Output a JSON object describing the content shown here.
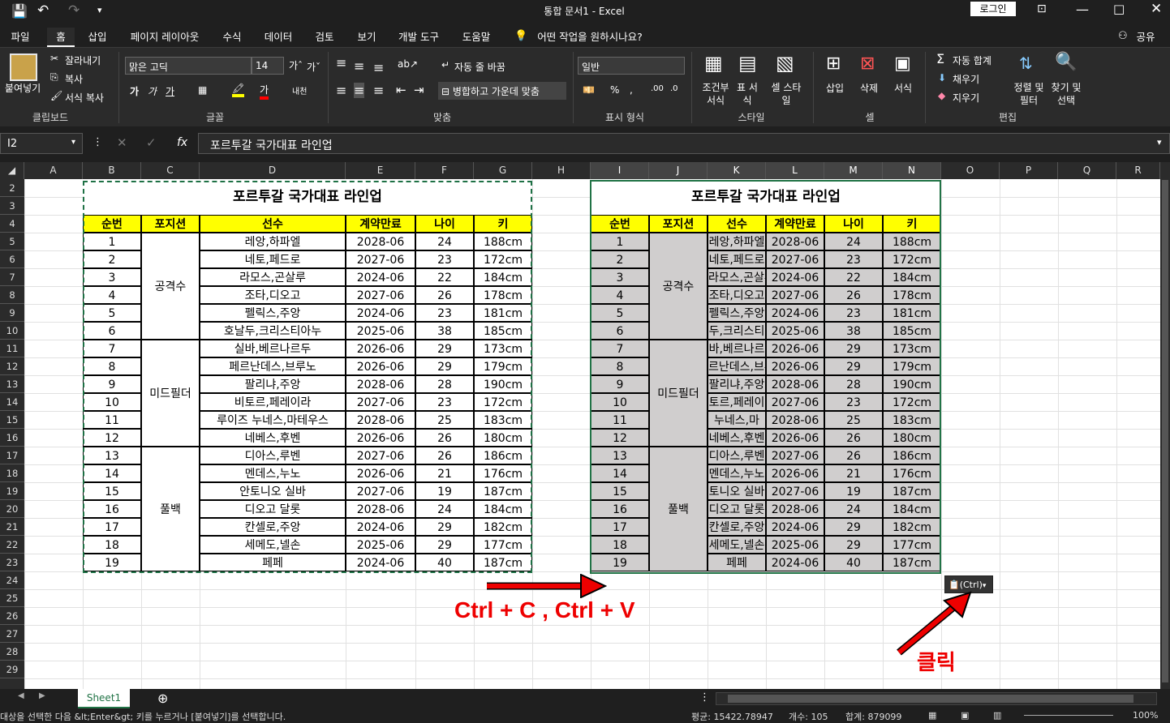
{
  "window": {
    "doc_title": "통합 문서1",
    "app": "Excel",
    "login": "로그인"
  },
  "tabs": [
    "파일",
    "홈",
    "삽입",
    "페이지 레이아웃",
    "수식",
    "데이터",
    "검토",
    "보기",
    "개발 도구",
    "도움말",
    "어떤 작업을 원하시나요?"
  ],
  "share": "공유",
  "ribbon": {
    "paste": "붙여넣기",
    "cut": "잘라내기",
    "copy": "복사",
    "format_painter": "서식 복사",
    "font_name": "맑은 고딕",
    "font_size": "14",
    "wrap": "자동 줄 바꿈",
    "merge": "병합하고 가운데 맞춤",
    "number_format": "일반",
    "cond_format": "조건부 서식",
    "table_format": "표 서식",
    "cell_style": "셀 스타일",
    "insert": "삽입",
    "delete": "삭제",
    "format": "서식",
    "autosum": "자동 합계",
    "fill": "채우기",
    "clear": "지우기",
    "sort": "정렬 및 필터",
    "find": "찾기 및 선택",
    "groups": [
      "클립보드",
      "글꼴",
      "맞춤",
      "표시 형식",
      "스타일",
      "셀",
      "편집"
    ]
  },
  "formula": {
    "name_box": "I2",
    "content": "포르투갈 국가대표 라인업"
  },
  "columns": [
    "A",
    "B",
    "C",
    "D",
    "E",
    "F",
    "G",
    "H",
    "I",
    "J",
    "K",
    "L",
    "M",
    "N",
    "O",
    "P",
    "Q",
    "R"
  ],
  "rows": [
    "2",
    "3",
    "4",
    "5",
    "6",
    "7",
    "8",
    "9",
    "10",
    "11",
    "12",
    "13",
    "14",
    "15",
    "16",
    "17",
    "18",
    "19",
    "20",
    "21",
    "22",
    "23",
    "24",
    "25",
    "26",
    "27",
    "28",
    "29"
  ],
  "table": {
    "title": "포르투갈 국가대표 라인업",
    "headers": [
      "순번",
      "포지션",
      "선수",
      "계약만료",
      "나이",
      "키"
    ],
    "positions": [
      "공격수",
      "미드필더",
      "풀백"
    ],
    "players": [
      [
        "1",
        "레앙,하파엘",
        "2028-06",
        "24",
        "188cm"
      ],
      [
        "2",
        "네토,페드로",
        "2027-06",
        "23",
        "172cm"
      ],
      [
        "3",
        "라모스,곤살루",
        "2024-06",
        "22",
        "184cm"
      ],
      [
        "4",
        "조타,디오고",
        "2027-06",
        "26",
        "178cm"
      ],
      [
        "5",
        "펠릭스,주앙",
        "2024-06",
        "23",
        "181cm"
      ],
      [
        "6",
        "호날두,크리스티아누",
        "2025-06",
        "38",
        "185cm"
      ],
      [
        "7",
        "실바,베르나르두",
        "2026-06",
        "29",
        "173cm"
      ],
      [
        "8",
        "페르난데스,브루노",
        "2026-06",
        "29",
        "179cm"
      ],
      [
        "9",
        "팔리냐,주앙",
        "2028-06",
        "28",
        "190cm"
      ],
      [
        "10",
        "비토르,페레이라",
        "2027-06",
        "23",
        "172cm"
      ],
      [
        "11",
        "루이즈 누네스,마테우스",
        "2028-06",
        "25",
        "183cm"
      ],
      [
        "12",
        "네베스,후벤",
        "2026-06",
        "26",
        "180cm"
      ],
      [
        "13",
        "디아스,루벤",
        "2027-06",
        "26",
        "186cm"
      ],
      [
        "14",
        "멘데스,누노",
        "2026-06",
        "21",
        "176cm"
      ],
      [
        "15",
        "안토니오 실바",
        "2027-06",
        "19",
        "187cm"
      ],
      [
        "16",
        "디오고 달롯",
        "2028-06",
        "24",
        "184cm"
      ],
      [
        "17",
        "칸셀로,주앙",
        "2024-06",
        "29",
        "182cm"
      ],
      [
        "18",
        "세메도,넬손",
        "2025-06",
        "29",
        "177cm"
      ],
      [
        "19",
        "페페",
        "2024-06",
        "40",
        "187cm"
      ]
    ],
    "pasted_names": [
      "레앙,하파엘",
      "네토,페드로",
      "라모스,곤살루",
      "조타,디오고",
      "펠릭스,주앙",
      "두,크리스티",
      "바,베르나르",
      "르난데스,브루",
      "팔리냐,주앙",
      "토르,페레이",
      "누네스,마",
      "네베스,후벤",
      "디아스,루벤",
      "멘데스,누노",
      "토니오 실바",
      "디오고 달롯",
      "칸셀로,주앙",
      "세메도,넬손",
      "페페"
    ]
  },
  "annotation": {
    "shortcut": "Ctrl + C , Ctrl + V",
    "click": "클릭",
    "paste_options": "(Ctrl)"
  },
  "sheet": "Sheet1",
  "status": {
    "message": "대상을 선택한 다음 &lt;Enter&gt; 키를 누르거나 [붙여넣기]를 선택합니다.",
    "average": "평균: 15422.78947",
    "count": "개수: 105",
    "sum": "합계: 879099",
    "zoom": "100%"
  }
}
